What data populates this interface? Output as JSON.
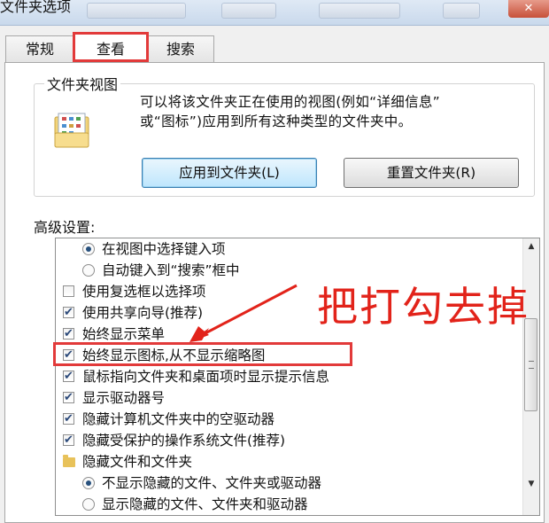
{
  "window": {
    "title": "文件夹选项",
    "close_glyph": "✕"
  },
  "tabs": [
    {
      "label": "常规",
      "active": false
    },
    {
      "label": "查看",
      "active": true
    },
    {
      "label": "搜索",
      "active": false
    }
  ],
  "folder_view": {
    "legend": "文件夹视图",
    "description_line1": "可以将该文件夹正在使用的视图(例如“详细信息”",
    "description_line2": "或“图标”)应用到所有这种类型的文件夹中。",
    "apply_button": "应用到文件夹(L)",
    "reset_button": "重置文件夹(R)"
  },
  "advanced": {
    "label": "高级设置:",
    "items": [
      {
        "type": "radio",
        "label": "在视图中选择键入项",
        "selected": true
      },
      {
        "type": "radio",
        "label": "自动键入到“搜索”框中",
        "selected": false
      },
      {
        "type": "checkbox",
        "label": "使用复选框以选择项",
        "checked": false
      },
      {
        "type": "checkbox",
        "label": "使用共享向导(推荐)",
        "checked": true
      },
      {
        "type": "checkbox",
        "label": "始终显示菜单",
        "checked": true
      },
      {
        "type": "checkbox",
        "label": "始终显示图标,从不显示缩略图",
        "checked": true
      },
      {
        "type": "checkbox",
        "label": "鼠标指向文件夹和桌面项时显示提示信息",
        "checked": true
      },
      {
        "type": "checkbox",
        "label": "显示驱动器号",
        "checked": true
      },
      {
        "type": "checkbox",
        "label": "隐藏计算机文件夹中的空驱动器",
        "checked": true
      },
      {
        "type": "checkbox",
        "label": "隐藏受保护的操作系统文件(推荐)",
        "checked": true
      },
      {
        "type": "folder",
        "label": "隐藏文件和文件夹"
      },
      {
        "type": "radio",
        "label": "不显示隐藏的文件、文件夹或驱动器",
        "selected": true
      },
      {
        "type": "radio",
        "label": "显示隐藏的文件、文件夹和驱动器",
        "selected": false
      }
    ]
  },
  "annotation": {
    "text": "把打勾去掉",
    "color": "#e2231a"
  },
  "icons": {
    "scroll_up": "▲",
    "scroll_down": "▼"
  }
}
